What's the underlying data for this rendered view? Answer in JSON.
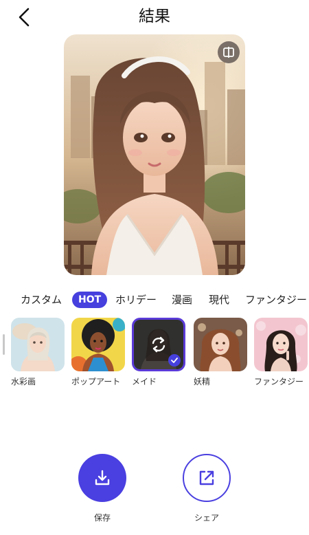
{
  "header": {
    "title": "結果"
  },
  "categories": [
    "カスタム",
    "HOT",
    "ホリデー",
    "漫画",
    "現代",
    "ファンタジー"
  ],
  "active_category": "HOT",
  "styles": [
    {
      "label": "水彩画",
      "selected": false
    },
    {
      "label": "ポップアート",
      "selected": false
    },
    {
      "label": "メイド",
      "selected": true
    },
    {
      "label": "妖精",
      "selected": false
    },
    {
      "label": "ファンタジー",
      "selected": false
    }
  ],
  "actions": {
    "save_label": "保存",
    "share_label": "シェア"
  },
  "colors": {
    "accent": "#4640de",
    "selection_outer": "#5a3ad8",
    "selection_inner": "#29a9e8"
  },
  "icons": {
    "back": "chevron-left-icon",
    "compare": "compare-icon",
    "regenerate": "regenerate-icon",
    "check": "check-icon",
    "save": "download-icon",
    "share": "share-icon"
  }
}
